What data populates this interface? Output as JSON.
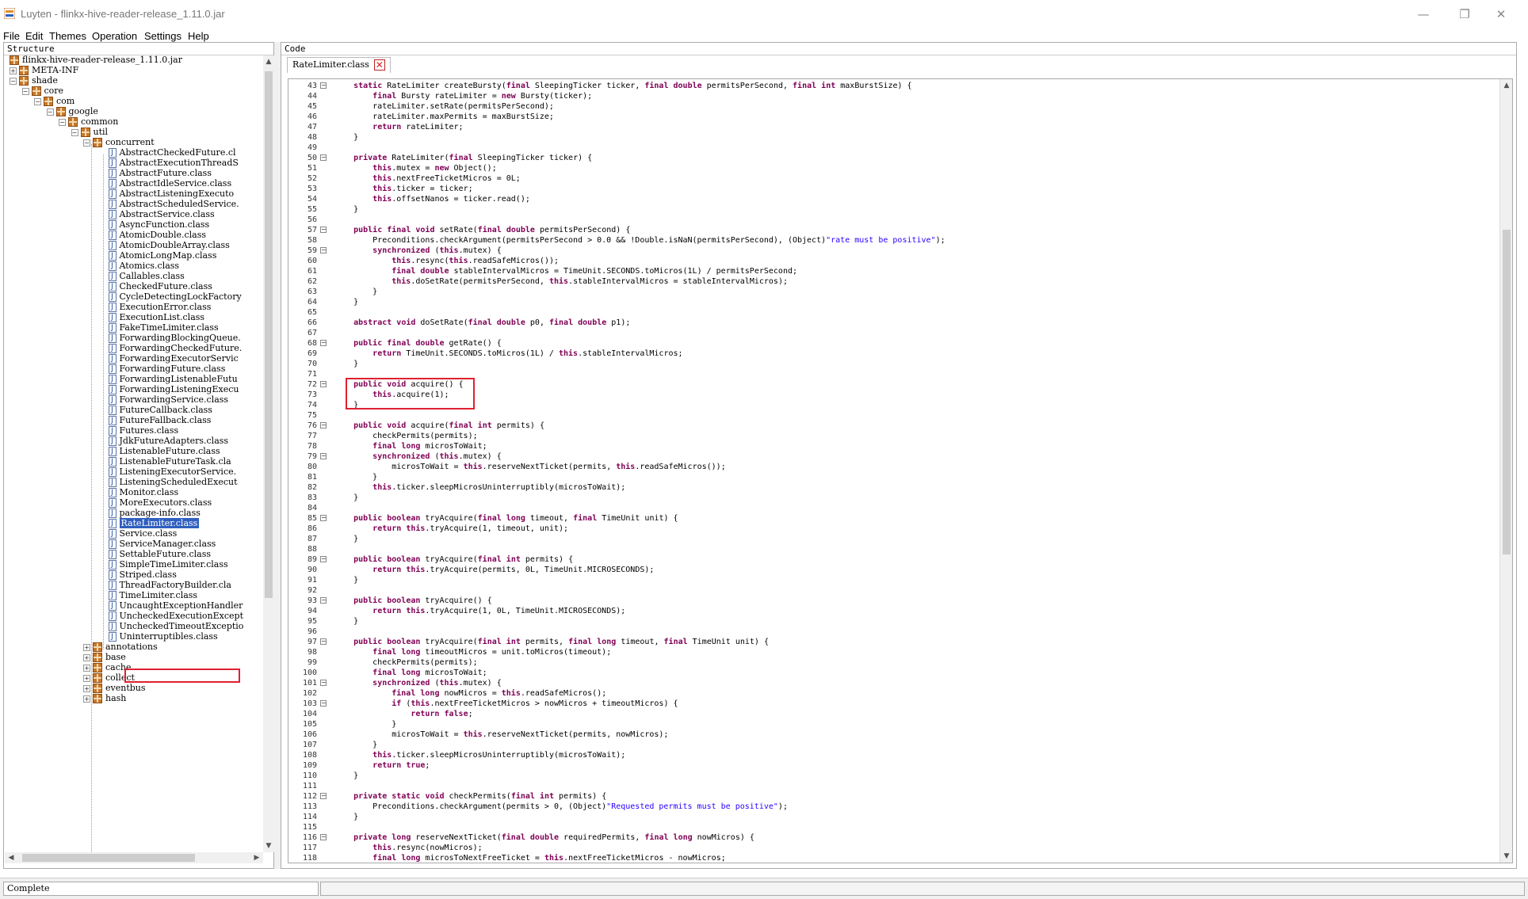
{
  "window": {
    "title": "Luyten - flinkx-hive-reader-release_1.11.0.jar",
    "minimize_glyph": "—",
    "restore_glyph": "❐",
    "close_glyph": "✕"
  },
  "menu": [
    "File",
    "Edit",
    "Themes",
    "Operation",
    "Settings",
    "Help"
  ],
  "structure": {
    "header": "Structure",
    "tree": [
      {
        "label": "flinkx-hive-reader-release_1.11.0.jar",
        "depth": 0,
        "kind": "jar",
        "toggle": ""
      },
      {
        "label": "META-INF",
        "depth": 0,
        "kind": "pkg",
        "toggle": "+"
      },
      {
        "label": "shade",
        "depth": 0,
        "kind": "pkg",
        "toggle": "-"
      },
      {
        "label": "core",
        "depth": 1,
        "kind": "pkg",
        "toggle": "-"
      },
      {
        "label": "com",
        "depth": 2,
        "kind": "pkg",
        "toggle": "-"
      },
      {
        "label": "google",
        "depth": 3,
        "kind": "pkg",
        "toggle": "-"
      },
      {
        "label": "common",
        "depth": 4,
        "kind": "pkg",
        "toggle": "-"
      },
      {
        "label": "util",
        "depth": 5,
        "kind": "pkg",
        "toggle": "-"
      },
      {
        "label": "concurrent",
        "depth": 6,
        "kind": "pkg",
        "toggle": "-"
      },
      {
        "label": "AbstractCheckedFuture.cl",
        "depth": 7,
        "kind": "class"
      },
      {
        "label": "AbstractExecutionThreadS",
        "depth": 7,
        "kind": "class"
      },
      {
        "label": "AbstractFuture.class",
        "depth": 7,
        "kind": "class"
      },
      {
        "label": "AbstractIdleService.class",
        "depth": 7,
        "kind": "class"
      },
      {
        "label": "AbstractListeningExecuto",
        "depth": 7,
        "kind": "class"
      },
      {
        "label": "AbstractScheduledService.",
        "depth": 7,
        "kind": "class"
      },
      {
        "label": "AbstractService.class",
        "depth": 7,
        "kind": "class"
      },
      {
        "label": "AsyncFunction.class",
        "depth": 7,
        "kind": "class"
      },
      {
        "label": "AtomicDouble.class",
        "depth": 7,
        "kind": "class"
      },
      {
        "label": "AtomicDoubleArray.class",
        "depth": 7,
        "kind": "class"
      },
      {
        "label": "AtomicLongMap.class",
        "depth": 7,
        "kind": "class"
      },
      {
        "label": "Atomics.class",
        "depth": 7,
        "kind": "class"
      },
      {
        "label": "Callables.class",
        "depth": 7,
        "kind": "class"
      },
      {
        "label": "CheckedFuture.class",
        "depth": 7,
        "kind": "class"
      },
      {
        "label": "CycleDetectingLockFactory",
        "depth": 7,
        "kind": "class"
      },
      {
        "label": "ExecutionError.class",
        "depth": 7,
        "kind": "class"
      },
      {
        "label": "ExecutionList.class",
        "depth": 7,
        "kind": "class"
      },
      {
        "label": "FakeTimeLimiter.class",
        "depth": 7,
        "kind": "class"
      },
      {
        "label": "ForwardingBlockingQueue.",
        "depth": 7,
        "kind": "class"
      },
      {
        "label": "ForwardingCheckedFuture.",
        "depth": 7,
        "kind": "class"
      },
      {
        "label": "ForwardingExecutorServic",
        "depth": 7,
        "kind": "class"
      },
      {
        "label": "ForwardingFuture.class",
        "depth": 7,
        "kind": "class"
      },
      {
        "label": "ForwardingListenableFutu",
        "depth": 7,
        "kind": "class"
      },
      {
        "label": "ForwardingListeningExecu",
        "depth": 7,
        "kind": "class"
      },
      {
        "label": "ForwardingService.class",
        "depth": 7,
        "kind": "class"
      },
      {
        "label": "FutureCallback.class",
        "depth": 7,
        "kind": "class"
      },
      {
        "label": "FutureFallback.class",
        "depth": 7,
        "kind": "class"
      },
      {
        "label": "Futures.class",
        "depth": 7,
        "kind": "class"
      },
      {
        "label": "JdkFutureAdapters.class",
        "depth": 7,
        "kind": "class"
      },
      {
        "label": "ListenableFuture.class",
        "depth": 7,
        "kind": "class"
      },
      {
        "label": "ListenableFutureTask.cla",
        "depth": 7,
        "kind": "class"
      },
      {
        "label": "ListeningExecutorService.",
        "depth": 7,
        "kind": "class"
      },
      {
        "label": "ListeningScheduledExecut",
        "depth": 7,
        "kind": "class"
      },
      {
        "label": "Monitor.class",
        "depth": 7,
        "kind": "class"
      },
      {
        "label": "MoreExecutors.class",
        "depth": 7,
        "kind": "class"
      },
      {
        "label": "package-info.class",
        "depth": 7,
        "kind": "class"
      },
      {
        "label": "RateLimiter.class",
        "depth": 7,
        "kind": "class",
        "selected": true
      },
      {
        "label": "Service.class",
        "depth": 7,
        "kind": "class"
      },
      {
        "label": "ServiceManager.class",
        "depth": 7,
        "kind": "class"
      },
      {
        "label": "SettableFuture.class",
        "depth": 7,
        "kind": "class"
      },
      {
        "label": "SimpleTimeLimiter.class",
        "depth": 7,
        "kind": "class"
      },
      {
        "label": "Striped.class",
        "depth": 7,
        "kind": "class"
      },
      {
        "label": "ThreadFactoryBuilder.cla",
        "depth": 7,
        "kind": "class"
      },
      {
        "label": "TimeLimiter.class",
        "depth": 7,
        "kind": "class"
      },
      {
        "label": "UncaughtExceptionHandler",
        "depth": 7,
        "kind": "class"
      },
      {
        "label": "UncheckedExecutionExcept",
        "depth": 7,
        "kind": "class"
      },
      {
        "label": "UncheckedTimeoutExceptio",
        "depth": 7,
        "kind": "class"
      },
      {
        "label": "Uninterruptibles.class",
        "depth": 7,
        "kind": "class"
      },
      {
        "label": "annotations",
        "depth": 6,
        "kind": "pkg",
        "toggle": "+"
      },
      {
        "label": "base",
        "depth": 6,
        "kind": "pkg",
        "toggle": "+"
      },
      {
        "label": "cache",
        "depth": 6,
        "kind": "pkg",
        "toggle": "+"
      },
      {
        "label": "collect",
        "depth": 6,
        "kind": "pkg",
        "toggle": "+"
      },
      {
        "label": "eventbus",
        "depth": 6,
        "kind": "pkg",
        "toggle": "+"
      },
      {
        "label": "hash",
        "depth": 6,
        "kind": "pkg",
        "toggle": "+"
      }
    ]
  },
  "code": {
    "header": "Code",
    "tab_label": "RateLimiter.class",
    "close_glyph": "✕",
    "lines": [
      {
        "n": "43",
        "fold": "-",
        "t": "    static RateLimiter createBursty(final SleepingTicker ticker, final double permitsPerSecond, final int maxBurstSize) {"
      },
      {
        "n": "44",
        "t": "        final Bursty rateLimiter = new Bursty(ticker);"
      },
      {
        "n": "45",
        "t": "        rateLimiter.setRate(permitsPerSecond);"
      },
      {
        "n": "46",
        "t": "        rateLimiter.maxPermits = maxBurstSize;"
      },
      {
        "n": "47",
        "t": "        return rateLimiter;"
      },
      {
        "n": "48",
        "t": "    }"
      },
      {
        "n": "49",
        "t": ""
      },
      {
        "n": "50",
        "fold": "-",
        "t": "    private RateLimiter(final SleepingTicker ticker) {"
      },
      {
        "n": "51",
        "t": "        this.mutex = new Object();"
      },
      {
        "n": "52",
        "t": "        this.nextFreeTicketMicros = 0L;"
      },
      {
        "n": "53",
        "t": "        this.ticker = ticker;"
      },
      {
        "n": "54",
        "t": "        this.offsetNanos = ticker.read();"
      },
      {
        "n": "55",
        "t": "    }"
      },
      {
        "n": "56",
        "t": ""
      },
      {
        "n": "57",
        "fold": "-",
        "t": "    public final void setRate(final double permitsPerSecond) {"
      },
      {
        "n": "58",
        "t": "        Preconditions.checkArgument(permitsPerSecond > 0.0 && !Double.isNaN(permitsPerSecond), (Object)\"rate must be positive\");"
      },
      {
        "n": "59",
        "fold": "-",
        "t": "        synchronized (this.mutex) {"
      },
      {
        "n": "60",
        "t": "            this.resync(this.readSafeMicros());"
      },
      {
        "n": "61",
        "t": "            final double stableIntervalMicros = TimeUnit.SECONDS.toMicros(1L) / permitsPerSecond;"
      },
      {
        "n": "62",
        "t": "            this.doSetRate(permitsPerSecond, this.stableIntervalMicros = stableIntervalMicros);"
      },
      {
        "n": "63",
        "t": "        }"
      },
      {
        "n": "64",
        "t": "    }"
      },
      {
        "n": "65",
        "t": ""
      },
      {
        "n": "66",
        "t": "    abstract void doSetRate(final double p0, final double p1);"
      },
      {
        "n": "67",
        "t": ""
      },
      {
        "n": "68",
        "fold": "-",
        "t": "    public final double getRate() {"
      },
      {
        "n": "69",
        "t": "        return TimeUnit.SECONDS.toMicros(1L) / this.stableIntervalMicros;"
      },
      {
        "n": "70",
        "t": "    }"
      },
      {
        "n": "71",
        "t": ""
      },
      {
        "n": "72",
        "fold": "-",
        "t": "    public void acquire() {"
      },
      {
        "n": "73",
        "t": "        this.acquire(1);"
      },
      {
        "n": "74",
        "t": "    }"
      },
      {
        "n": "75",
        "t": ""
      },
      {
        "n": "76",
        "fold": "-",
        "t": "    public void acquire(final int permits) {"
      },
      {
        "n": "77",
        "t": "        checkPermits(permits);"
      },
      {
        "n": "78",
        "t": "        final long microsToWait;"
      },
      {
        "n": "79",
        "fold": "-",
        "t": "        synchronized (this.mutex) {"
      },
      {
        "n": "80",
        "t": "            microsToWait = this.reserveNextTicket(permits, this.readSafeMicros());"
      },
      {
        "n": "81",
        "t": "        }"
      },
      {
        "n": "82",
        "t": "        this.ticker.sleepMicrosUninterruptibly(microsToWait);"
      },
      {
        "n": "83",
        "t": "    }"
      },
      {
        "n": "84",
        "t": ""
      },
      {
        "n": "85",
        "fold": "-",
        "t": "    public boolean tryAcquire(final long timeout, final TimeUnit unit) {"
      },
      {
        "n": "86",
        "t": "        return this.tryAcquire(1, timeout, unit);"
      },
      {
        "n": "87",
        "t": "    }"
      },
      {
        "n": "88",
        "t": ""
      },
      {
        "n": "89",
        "fold": "-",
        "t": "    public boolean tryAcquire(final int permits) {"
      },
      {
        "n": "90",
        "t": "        return this.tryAcquire(permits, 0L, TimeUnit.MICROSECONDS);"
      },
      {
        "n": "91",
        "t": "    }"
      },
      {
        "n": "92",
        "t": ""
      },
      {
        "n": "93",
        "fold": "-",
        "t": "    public boolean tryAcquire() {"
      },
      {
        "n": "94",
        "t": "        return this.tryAcquire(1, 0L, TimeUnit.MICROSECONDS);"
      },
      {
        "n": "95",
        "t": "    }"
      },
      {
        "n": "96",
        "t": ""
      },
      {
        "n": "97",
        "fold": "-",
        "t": "    public boolean tryAcquire(final int permits, final long timeout, final TimeUnit unit) {"
      },
      {
        "n": "98",
        "t": "        final long timeoutMicros = unit.toMicros(timeout);"
      },
      {
        "n": "99",
        "t": "        checkPermits(permits);"
      },
      {
        "n": "100",
        "t": "        final long microsToWait;"
      },
      {
        "n": "101",
        "fold": "-",
        "t": "        synchronized (this.mutex) {"
      },
      {
        "n": "102",
        "t": "            final long nowMicros = this.readSafeMicros();"
      },
      {
        "n": "103",
        "fold": "-",
        "t": "            if (this.nextFreeTicketMicros > nowMicros + timeoutMicros) {"
      },
      {
        "n": "104",
        "t": "                return false;"
      },
      {
        "n": "105",
        "t": "            }"
      },
      {
        "n": "106",
        "t": "            microsToWait = this.reserveNextTicket(permits, nowMicros);"
      },
      {
        "n": "107",
        "t": "        }"
      },
      {
        "n": "108",
        "t": "        this.ticker.sleepMicrosUninterruptibly(microsToWait);"
      },
      {
        "n": "109",
        "t": "        return true;"
      },
      {
        "n": "110",
        "t": "    }"
      },
      {
        "n": "111",
        "t": ""
      },
      {
        "n": "112",
        "fold": "-",
        "t": "    private static void checkPermits(final int permits) {"
      },
      {
        "n": "113",
        "t": "        Preconditions.checkArgument(permits > 0, (Object)\"Requested permits must be positive\");"
      },
      {
        "n": "114",
        "t": "    }"
      },
      {
        "n": "115",
        "t": ""
      },
      {
        "n": "116",
        "fold": "-",
        "t": "    private long reserveNextTicket(final double requiredPermits, final long nowMicros) {"
      },
      {
        "n": "117",
        "t": "        this.resync(nowMicros);"
      },
      {
        "n": "118",
        "t": "        final long microsToNextFreeTicket = this.nextFreeTicketMicros - nowMicros;"
      }
    ]
  },
  "status": {
    "text": "Complete"
  },
  "colors": {
    "keyword": "#7f0055",
    "string": "#2a00ff",
    "highlight_box": "#e02030",
    "selection": "#2f5fbf"
  }
}
